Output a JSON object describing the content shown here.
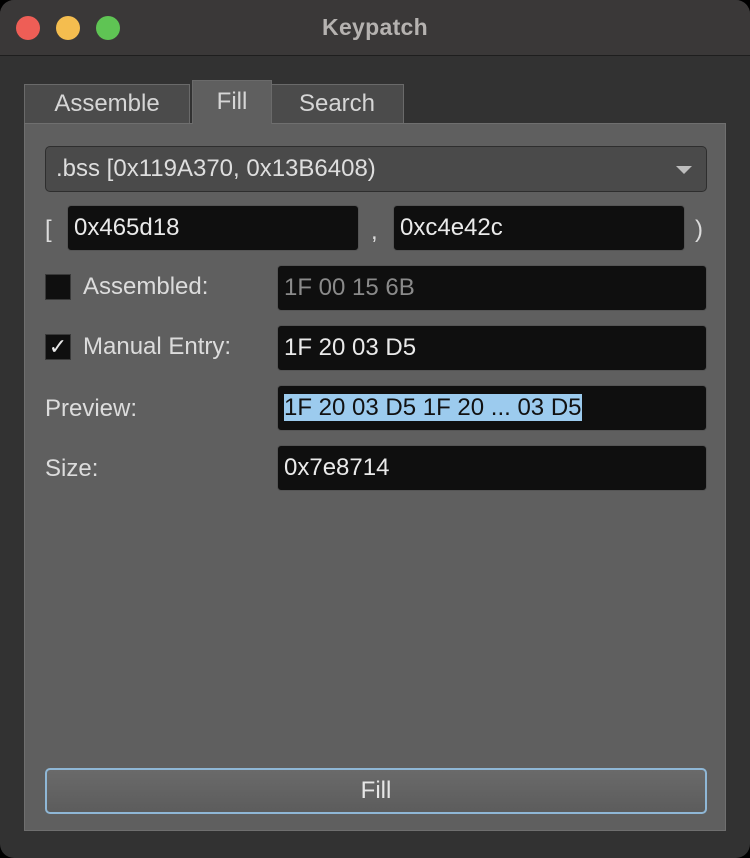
{
  "window": {
    "title": "Keypatch"
  },
  "tabs": [
    {
      "label": "Assemble",
      "active": false
    },
    {
      "label": "Fill",
      "active": true
    },
    {
      "label": "Search",
      "active": false
    }
  ],
  "segment": {
    "selected": ".bss [0x119A370, 0x13B6408)"
  },
  "range": {
    "open_bracket": "[",
    "start": "0x465d18",
    "separator": ",",
    "end": "0xc4e42c",
    "close_bracket": ")"
  },
  "assembled": {
    "label": "Assembled:",
    "checked": false,
    "value": "1F 00 15 6B"
  },
  "manual_entry": {
    "label": "Manual Entry:",
    "checked": true,
    "check_glyph": "✓",
    "value": "1F 20 03 D5"
  },
  "preview": {
    "label": "Preview:",
    "value": "1F 20 03 D5 1F 20 ... 03 D5"
  },
  "size": {
    "label": "Size:",
    "value": "0x7e8714"
  },
  "actions": {
    "fill_label": "Fill"
  },
  "colors": {
    "selection_highlight": "#9ccbee",
    "focus_border": "#8fb7d6"
  }
}
